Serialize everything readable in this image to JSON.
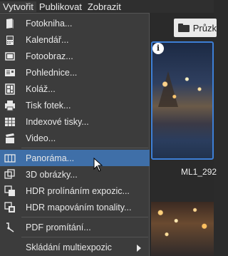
{
  "menubar": {
    "items": [
      {
        "label": "Vytvořit",
        "active": true
      },
      {
        "label": "Publikovat",
        "active": false
      },
      {
        "label": "Zobrazit",
        "active": false
      }
    ]
  },
  "dropdown": {
    "items": [
      {
        "label": "Fotokniha...",
        "icon": "photobook-icon"
      },
      {
        "label": "Kalendář...",
        "icon": "calendar-icon"
      },
      {
        "label": "Fotoobraz...",
        "icon": "photo-canvas-icon"
      },
      {
        "label": "Pohlednice...",
        "icon": "postcard-icon"
      },
      {
        "label": "Koláž...",
        "icon": "collage-icon"
      },
      {
        "label": "Tisk fotek...",
        "icon": "printer-icon"
      },
      {
        "label": "Indexové tisky...",
        "icon": "index-print-icon"
      },
      {
        "label": "Video...",
        "icon": "video-clapper-icon"
      },
      {
        "label": "Panoráma...",
        "icon": "panorama-icon",
        "highlighted": true
      },
      {
        "label": "3D obrázky...",
        "icon": "3d-image-icon"
      },
      {
        "label": "HDR prolínáním expozic...",
        "icon": "hdr-blend-icon"
      },
      {
        "label": "HDR mapováním tonality...",
        "icon": "hdr-tonemap-icon"
      },
      {
        "label": "PDF promítání...",
        "icon": "pdf-slideshow-icon"
      },
      {
        "label": "Skládání multiexpozic",
        "icon": "",
        "submenu": true
      }
    ]
  },
  "toolbar": {
    "button_label": "Průzk"
  },
  "thumbnail": {
    "label": "ML1_292"
  },
  "colors": {
    "highlight": "#3f6fa8",
    "selection_border": "#3d7fd6"
  }
}
